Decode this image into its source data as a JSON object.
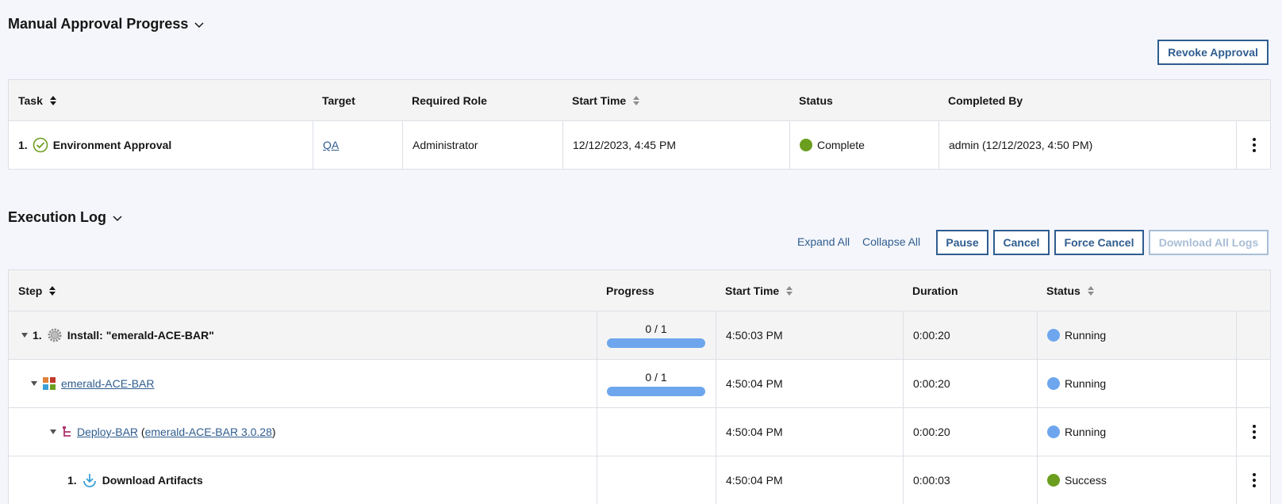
{
  "approval": {
    "title": "Manual Approval Progress",
    "revoke_label": "Revoke Approval",
    "columns": [
      "Task",
      "Target",
      "Required Role",
      "Start Time",
      "Status",
      "Completed By"
    ],
    "row": {
      "index": "1.",
      "task": "Environment Approval",
      "target": "QA",
      "role": "Administrator",
      "start": "12/12/2023, 4:45 PM",
      "status": "Complete",
      "completed_by": "admin (12/12/2023, 4:50 PM)"
    }
  },
  "log": {
    "title": "Execution Log",
    "expand_all": "Expand All",
    "collapse_all": "Collapse All",
    "pause": "Pause",
    "cancel": "Cancel",
    "force_cancel": "Force Cancel",
    "download_all": "Download All Logs",
    "columns": [
      "Step",
      "Progress",
      "Start Time",
      "Duration",
      "Status"
    ],
    "rows": [
      {
        "index": "1.",
        "name": "Install: \"emerald-ACE-BAR\"",
        "progress": "0 / 1",
        "progress_value": 0,
        "start": "4:50:03 PM",
        "duration": "0:00:20",
        "status": "Running"
      },
      {
        "name": "emerald-ACE-BAR",
        "progress": "0 / 1",
        "progress_value": 0,
        "start": "4:50:04 PM",
        "duration": "0:00:20",
        "status": "Running"
      },
      {
        "name": "Deploy-BAR",
        "sub": "emerald-ACE-BAR 3.0.28",
        "start": "4:50:04 PM",
        "duration": "0:00:20",
        "status": "Running"
      },
      {
        "index": "1.",
        "name": "Download Artifacts",
        "start": "4:50:04 PM",
        "duration": "0:00:03",
        "status": "Success"
      }
    ]
  },
  "colors": {
    "running": "#6ea6ee",
    "success": "#6b9e1f",
    "complete": "#6b9e1f",
    "link": "#2f5d8f"
  }
}
